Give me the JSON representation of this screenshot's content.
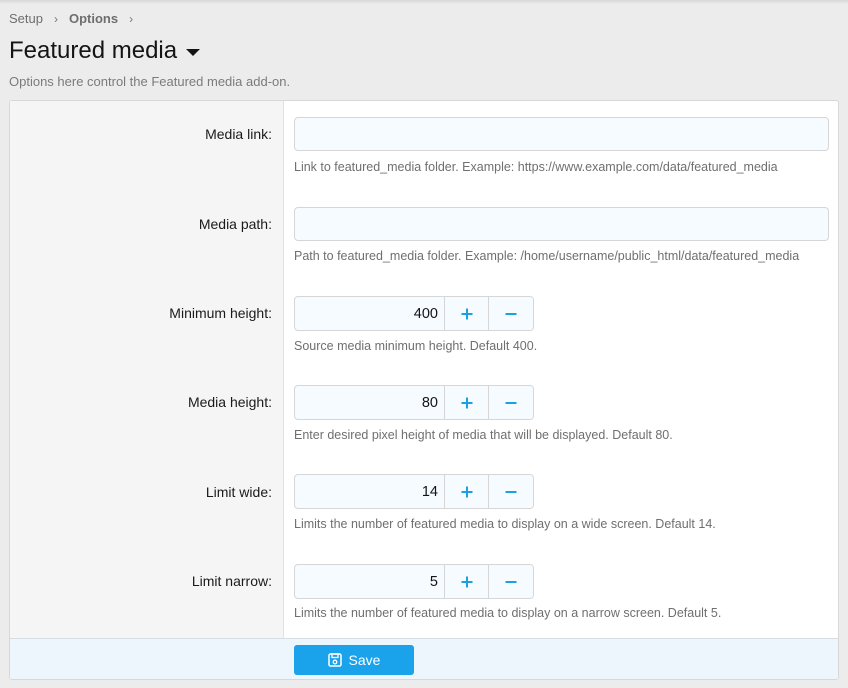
{
  "breadcrumb": [
    {
      "label": "Setup"
    },
    {
      "label": "Options"
    }
  ],
  "breadcrumb_separator": "›",
  "page": {
    "title": "Featured media",
    "description": "Options here control the Featured media add-on."
  },
  "fields": {
    "media_link": {
      "label": "Media link:",
      "value": "",
      "hint": "Link to featured_media folder. Example: https://www.example.com/data/featured_media"
    },
    "media_path": {
      "label": "Media path:",
      "value": "",
      "hint": "Path to featured_media folder. Example: /home/username/public_html/data/featured_media"
    },
    "minimum_height": {
      "label": "Minimum height:",
      "value": "400",
      "hint": "Source media minimum height. Default 400."
    },
    "media_height": {
      "label": "Media height:",
      "value": "80",
      "hint": "Enter desired pixel height of media that will be displayed. Default 80."
    },
    "limit_wide": {
      "label": "Limit wide:",
      "value": "14",
      "hint": "Limits the number of featured media to display on a wide screen. Default 14."
    },
    "limit_narrow": {
      "label": "Limit narrow:",
      "value": "5",
      "hint": "Limits the number of featured media to display on a narrow screen. Default 5."
    }
  },
  "stepper": {
    "increment_icon": "plus-icon",
    "decrement_icon": "minus-icon"
  },
  "footer": {
    "save_label": "Save",
    "save_icon": "floppy-disk-icon"
  },
  "colors": {
    "accent": "#1aa3eb",
    "stepper_icon": "#1ba0e0",
    "input_bg": "#f5fbff",
    "footer_bg": "#edf6fd"
  }
}
